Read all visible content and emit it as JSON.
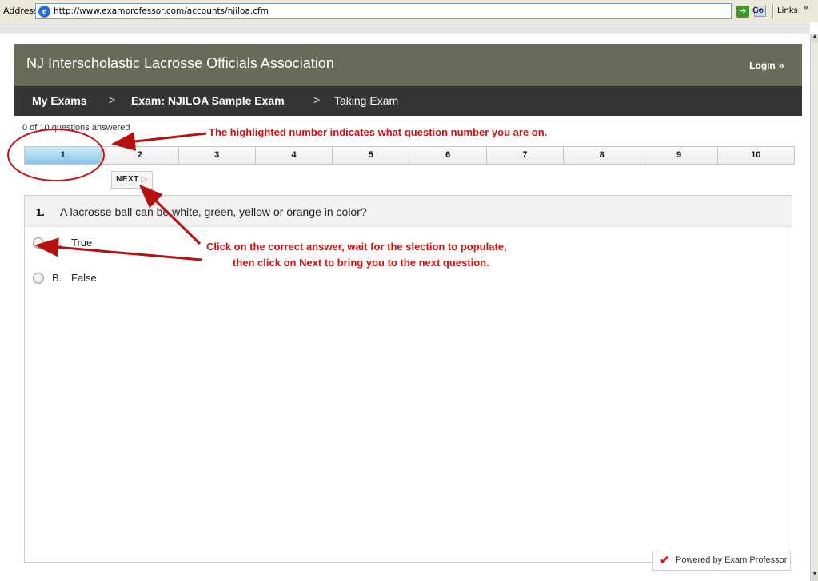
{
  "browser": {
    "address_label": "Address",
    "url": "http://www.examprofessor.com/accounts/njiloa.cfm",
    "go_label": "Go",
    "links_label": "Links",
    "links_chevron": "»"
  },
  "header": {
    "title": "NJ Interscholastic Lacrosse Officials Association",
    "login_label": "Login",
    "login_chevron": "»"
  },
  "breadcrumb": {
    "items": [
      "My Exams",
      "Exam: NJILOA Sample Exam",
      "Taking Exam"
    ],
    "separator": ">"
  },
  "progress": {
    "answered_text": "0 of 10 questions answered"
  },
  "question_tabs": [
    "1",
    "2",
    "3",
    "4",
    "5",
    "6",
    "7",
    "8",
    "9",
    "10"
  ],
  "active_question": "1",
  "next_button": {
    "label": "NEXT",
    "icon": "▷"
  },
  "question": {
    "number": "1.",
    "text": "A lacrosse ball can be white, green, yellow or orange in color?",
    "options": [
      {
        "letter": "A.",
        "text": "True"
      },
      {
        "letter": "B.",
        "text": "False"
      }
    ]
  },
  "footer": {
    "powered_by": "Powered by Exam Professor"
  },
  "annotations": {
    "highlight_note": "The highlighted number indicates what question number you are on.",
    "click_note_line1": "Click on the correct answer, wait for the slection to populate,",
    "click_note_line2": "then click on Next to bring you to the next question."
  },
  "colors": {
    "header_bg": "#686b58",
    "breadcrumb_bg": "#353535",
    "active_tab": "#8cc6e6",
    "annotation_red": "#cc1111"
  },
  "icons": {
    "browser": "ie-icon",
    "go": "go-arrow-icon",
    "powered": "checkmark-icon"
  }
}
